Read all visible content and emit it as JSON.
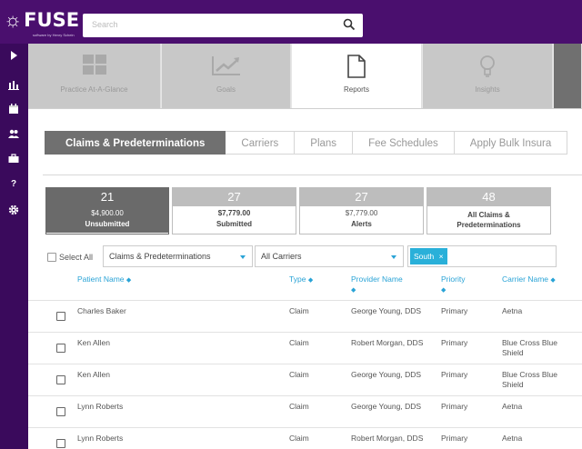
{
  "app": {
    "logo": "FUSE",
    "tagline": "software by Henry Schein"
  },
  "search": {
    "placeholder": "Search"
  },
  "nav_tiles": [
    {
      "label": "Practice At-A-Glance",
      "icon": "grid-icon"
    },
    {
      "label": "Goals",
      "icon": "trend-chart-icon"
    },
    {
      "label": "Reports",
      "icon": "document-icon"
    },
    {
      "label": "Insights",
      "icon": "lightbulb-icon"
    }
  ],
  "subtabs": [
    "Claims & Predeterminations",
    "Carriers",
    "Plans",
    "Fee Schedules",
    "Apply Bulk Insura"
  ],
  "summary": [
    {
      "count": "21",
      "amount": "$4,900.00",
      "label": "Unsubmitted"
    },
    {
      "count": "27",
      "amount": "$7,779.00",
      "label": "Submitted"
    },
    {
      "count": "27",
      "amount": "$7,779.00",
      "label": "Alerts"
    },
    {
      "count": "48",
      "amount": "",
      "label": "All Claims & Predeterminations"
    }
  ],
  "filters": {
    "select_all": "Select All",
    "claim_type": "Claims & Predeterminations",
    "carrier": "All Carriers",
    "region_chip": "South",
    "chip_remove": "×"
  },
  "table": {
    "headers": {
      "patient": "Patient Name",
      "type": "Type",
      "provider": "Provider Name",
      "priority": "Priority",
      "carrier": "Carrier Name"
    },
    "rows": [
      {
        "patient": "Charles Baker",
        "type": "Claim",
        "provider": "George Young, DDS",
        "priority": "Primary",
        "carrier": "Aetna"
      },
      {
        "patient": "Ken Allen",
        "type": "Claim",
        "provider": "Robert Morgan, DDS",
        "priority": "Primary",
        "carrier": "Blue Cross Blue Shield"
      },
      {
        "patient": "Ken Allen",
        "type": "Claim",
        "provider": "George Young, DDS",
        "priority": "Primary",
        "carrier": "Blue Cross Blue Shield"
      },
      {
        "patient": "Lynn Roberts",
        "type": "Claim",
        "provider": "George Young, DDS",
        "priority": "Primary",
        "carrier": "Aetna"
      },
      {
        "patient": "Lynn Roberts",
        "type": "Claim",
        "provider": "Robert Morgan, DDS",
        "priority": "Primary",
        "carrier": "Aetna"
      }
    ]
  },
  "sidebar": {
    "items": [
      {
        "icon": "expand-arrow-icon"
      },
      {
        "icon": "bar-chart-icon"
      },
      {
        "icon": "calendar-icon"
      },
      {
        "icon": "people-icon"
      },
      {
        "icon": "briefcase-icon"
      },
      {
        "icon": "help-icon",
        "text": "?"
      },
      {
        "icon": "gear-icon"
      }
    ]
  },
  "colors": {
    "purple": "#4a0f6e",
    "accent": "#29a3d6",
    "tab_active": "#707070"
  }
}
